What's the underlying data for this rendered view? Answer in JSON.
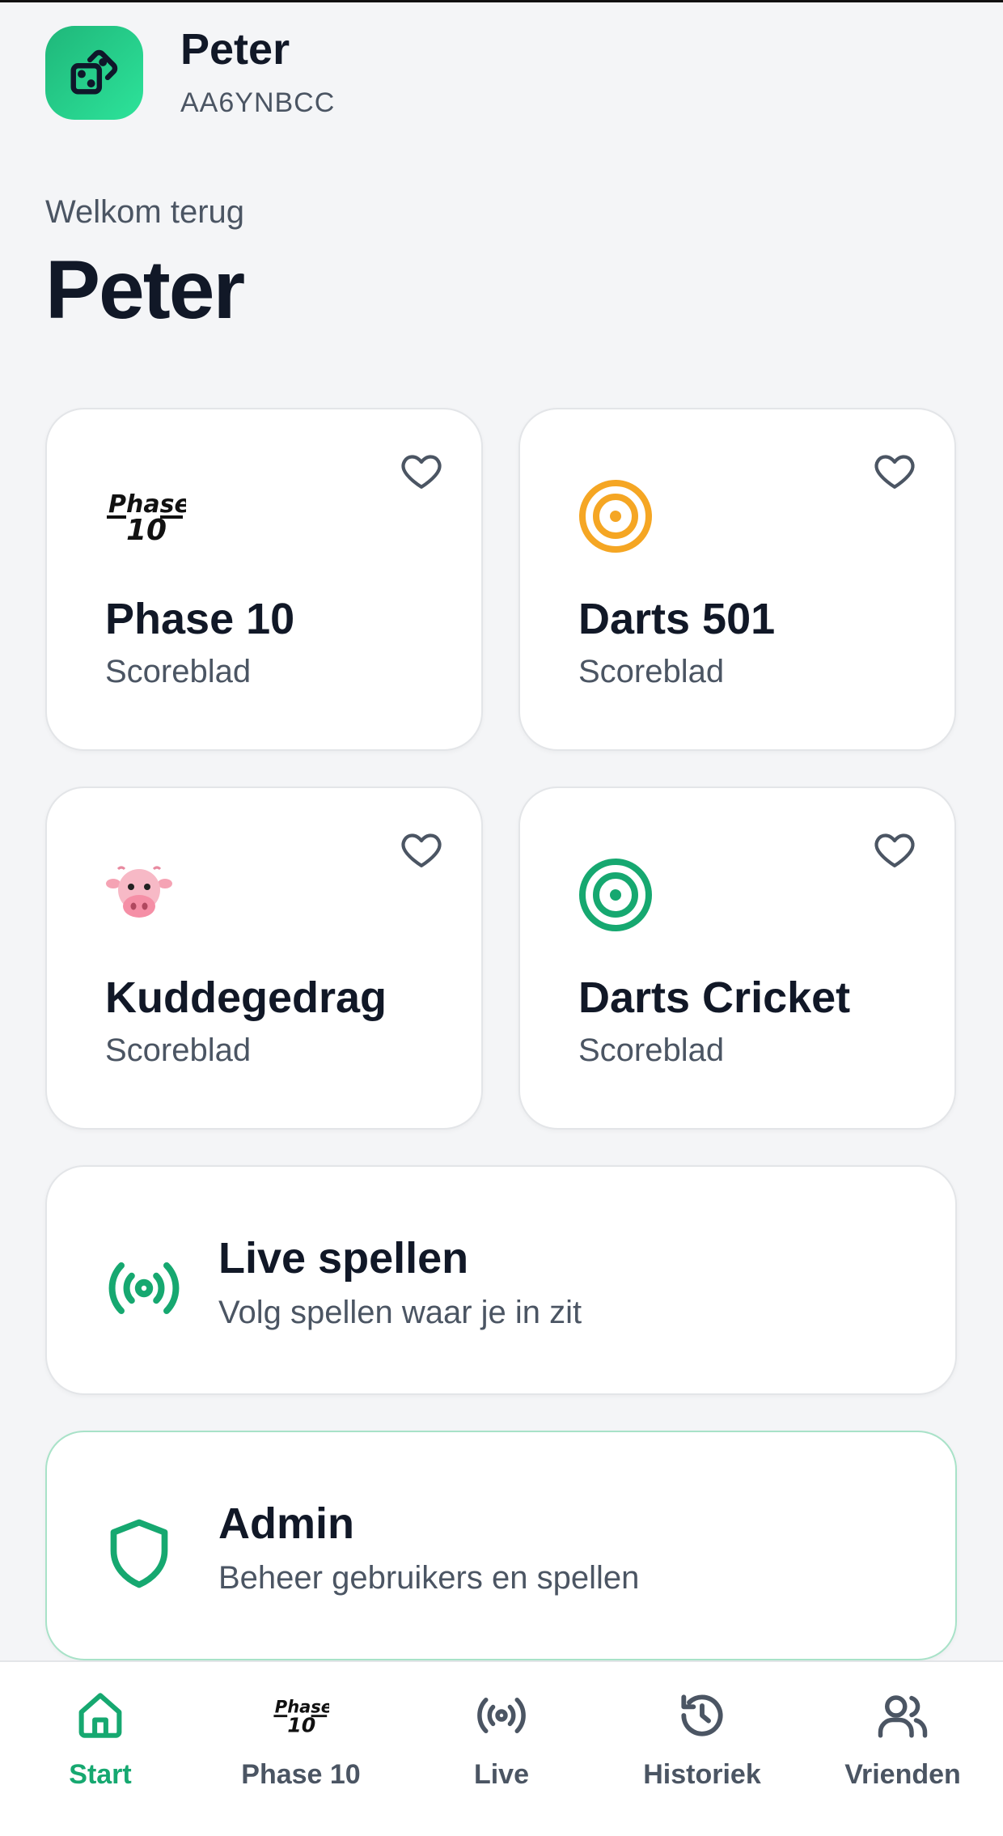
{
  "header": {
    "name": "Peter",
    "code": "AA6YNBCC",
    "avatar_icon": "dice-icon"
  },
  "welcome": {
    "greeting": "Welkom terug",
    "name": "Peter"
  },
  "games": [
    {
      "title": "Phase 10",
      "subtitle": "Scoreblad",
      "icon": "phase10-logo"
    },
    {
      "title": "Darts 501",
      "subtitle": "Scoreblad",
      "icon": "target-icon-orange"
    },
    {
      "title": "Kuddegedrag",
      "subtitle": "Scoreblad",
      "icon": "cow-icon"
    },
    {
      "title": "Darts Cricket",
      "subtitle": "Scoreblad",
      "icon": "target-icon-green"
    }
  ],
  "logo_text": {
    "top": "Phase",
    "bottom": "10"
  },
  "live_card": {
    "title": "Live spellen",
    "subtitle": "Volg spellen waar je in zit",
    "icon": "broadcast-icon"
  },
  "admin_card": {
    "title": "Admin",
    "subtitle": "Beheer gebruikers en spellen",
    "icon": "shield-icon"
  },
  "nav": [
    {
      "label": "Start",
      "icon": "home-icon",
      "active": true
    },
    {
      "label": "Phase 10",
      "icon": "phase10-logo",
      "active": false
    },
    {
      "label": "Live",
      "icon": "broadcast-icon",
      "active": false
    },
    {
      "label": "Historiek",
      "icon": "history-icon",
      "active": false
    },
    {
      "label": "Vrienden",
      "icon": "friends-icon",
      "active": false
    }
  ],
  "colors": {
    "accent": "#16a870",
    "orange": "#f5a623",
    "text": "#111827",
    "muted": "#4b5563"
  }
}
